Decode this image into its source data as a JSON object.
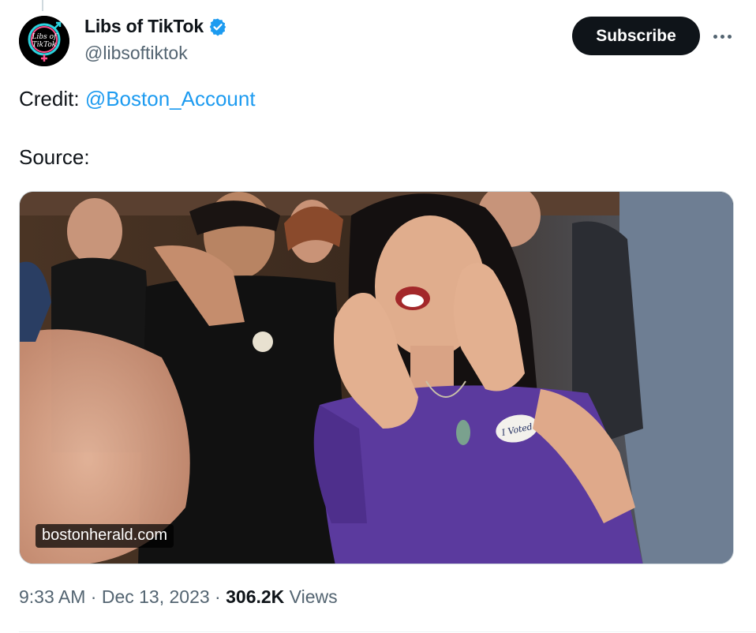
{
  "author": {
    "display_name": "Libs of TikTok",
    "handle": "@libsoftiktok",
    "avatar_text_top": "Libs of",
    "avatar_text_bottom": "TikTok"
  },
  "actions": {
    "subscribe_label": "Subscribe"
  },
  "tweet": {
    "credit_prefix": "Credit: ",
    "credit_mention": "@Boston_Account",
    "source_label": "Source:"
  },
  "media": {
    "domain_label": "bostonherald.com",
    "sticker_text": "I Voted"
  },
  "meta": {
    "time": "9:33 AM",
    "sep1": " · ",
    "date": "Dec 13, 2023",
    "sep2": " · ",
    "views_count": "306.2K",
    "views_label": " Views"
  },
  "colors": {
    "accent": "#1d9bf0",
    "verified": "#1d9bf0",
    "text_secondary": "#536471",
    "dress": "#5b3a9e"
  }
}
